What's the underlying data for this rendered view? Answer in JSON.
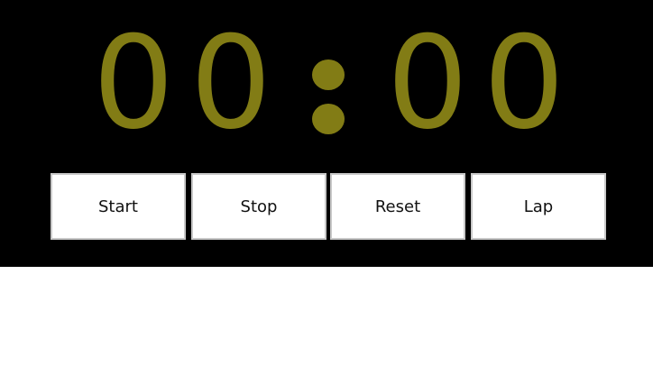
{
  "timer": {
    "minutes_tens": "0",
    "minutes_ones": "0",
    "separator": ":",
    "seconds_tens": "0",
    "seconds_ones": "0",
    "digit_color": "#827c15"
  },
  "controls": {
    "start_label": "Start",
    "stop_label": "Stop",
    "reset_label": "Reset",
    "lap_label": "Lap"
  },
  "theme": {
    "panel_background": "#000000",
    "page_background": "#ffffff"
  }
}
